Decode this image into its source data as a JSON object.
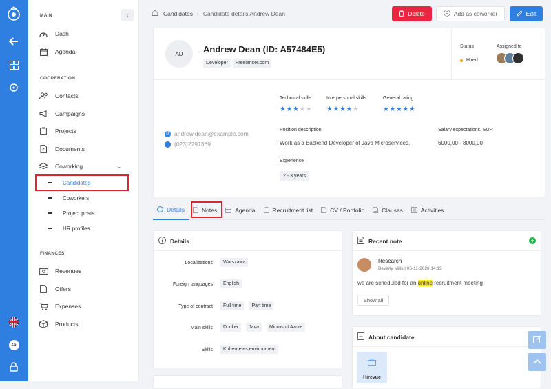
{
  "nav": {
    "sections": {
      "main": "MAIN",
      "cooperation": "COOPERATION",
      "finances": "FINANCES"
    },
    "items": {
      "dash": "Dash",
      "agenda": "Agenda",
      "contacts": "Contacts",
      "campaigns": "Campaigns",
      "projects": "Projects",
      "documents": "Documents",
      "coworking": "Coworking",
      "candidates": "Candidates",
      "coworkers": "Coworkers",
      "project_posts": "Project posts",
      "hr_profiles": "HR profiles",
      "revenues": "Revenues",
      "offers": "Offers",
      "expenses": "Expenses",
      "products": "Products"
    },
    "user_initials": "ZS"
  },
  "breadcrumb": {
    "root": "Candidates",
    "sep": "›",
    "current": "Candidate details Andrew Dean"
  },
  "actions": {
    "delete": "Delete",
    "add_coworker": "Add as coworker",
    "edit": "Edit"
  },
  "profile": {
    "initials": "AD",
    "name": "Andrew Dean (ID: A57484E5)",
    "tags": [
      "Developer",
      "Freelancer.com"
    ],
    "status_label": "Status",
    "status_value": "Hired",
    "assigned_label": "Assigned to",
    "email": "andrew.dean@example.com",
    "phone": "(023)2297369",
    "technical_skills_label": "Technical skills",
    "technical_skills_rating": 3,
    "interpersonal_skills_label": "Interpersonal skills",
    "interpersonal_skills_rating": 4,
    "general_rating_label": "General rating",
    "general_rating": 5,
    "position_label": "Position description",
    "position_value": "Work as a Backend Developer of Java Microservices.",
    "salary_label": "Salary expectations, EUR",
    "salary_value": "6000,00 - 8000,00",
    "experience_label": "Experience",
    "experience_value": "2 - 3 years"
  },
  "tabs": [
    "Details",
    "Notes",
    "Agenda",
    "Recruitment list",
    "CV / Portfolio",
    "Clauses",
    "Activities"
  ],
  "details": {
    "title": "Details",
    "localizations_label": "Localizations",
    "localizations": [
      "Warszawa"
    ],
    "languages_label": "Foreign languages",
    "languages": [
      "English"
    ],
    "contract_label": "Type of contract",
    "contract": [
      "Full time",
      "Part time"
    ],
    "main_skills_label": "Main skills",
    "main_skills": [
      "Docker",
      "Java",
      "Microsoft Azure"
    ],
    "skills_label": "Skills",
    "skills": [
      "Kubernetes environment"
    ]
  },
  "recent_note": {
    "title": "Recent note",
    "note_title": "Research",
    "author_date": "Beverly Mills | 06-11-2020 14:19",
    "text_before": "we are scheduled for an ",
    "text_highlight": "online",
    "text_after": " recruitment meeting",
    "show_all": "Show all"
  },
  "about": {
    "title": "About candidate",
    "company": "Hirevue"
  },
  "colors": {
    "accent": "#2e7fe0",
    "danger": "#e8263f",
    "highlight": "#ffef00",
    "star_on": "#2e7fe0",
    "star_off": "#c9ccd3"
  }
}
